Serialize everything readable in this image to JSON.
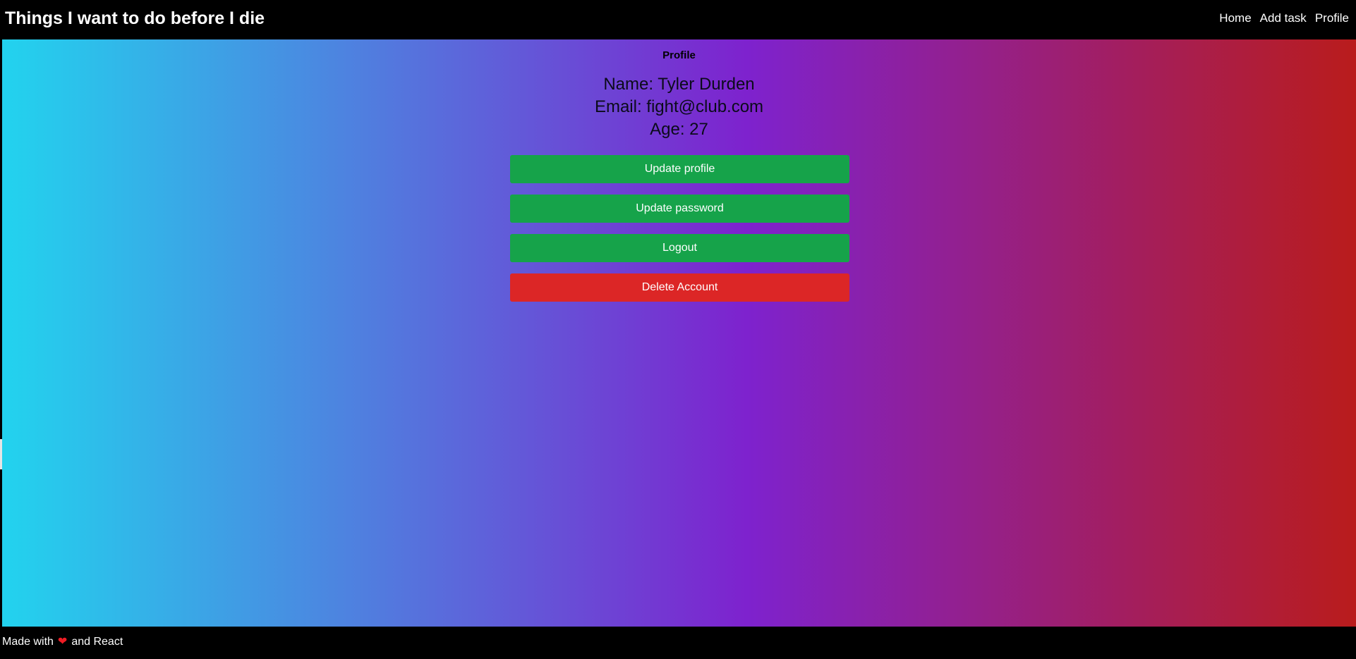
{
  "header": {
    "title": "Things I want to do before I die",
    "nav": {
      "home": "Home",
      "add_task": "Add task",
      "profile": "Profile"
    }
  },
  "main": {
    "heading": "Profile",
    "name_line": "Name: Tyler Durden",
    "email_line": "Email: fight@club.com",
    "age_line": "Age: 27",
    "buttons": {
      "update_profile": "Update profile",
      "update_password": "Update password",
      "logout": "Logout",
      "delete_account": "Delete Account"
    }
  },
  "footer": {
    "made_with": "Made with",
    "heart_icon": "heart-icon",
    "and_react": "and React"
  },
  "colors": {
    "gradient_start": "#22d3ee",
    "gradient_mid": "#7e22ce",
    "gradient_end": "#b91c1c",
    "button_green": "#16a34a",
    "button_red": "#dc2626",
    "heart": "#ef1c24"
  }
}
